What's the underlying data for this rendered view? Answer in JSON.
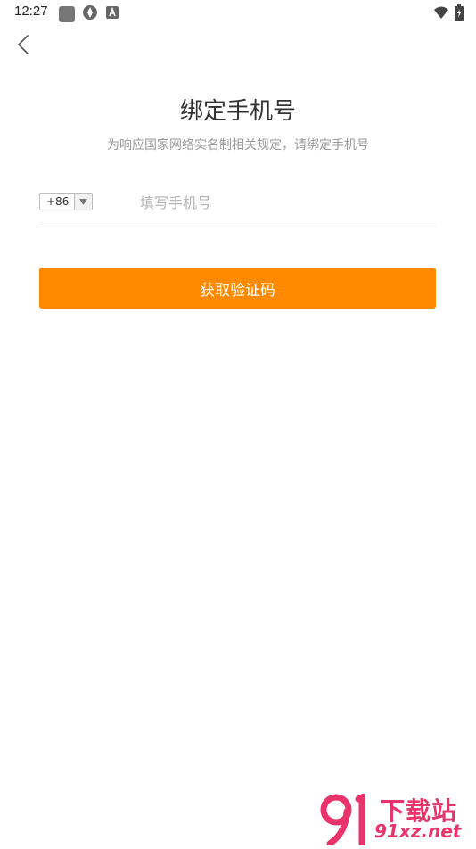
{
  "status_bar": {
    "time": "12:27"
  },
  "header": {
    "title": "绑定手机号",
    "subtitle": "为响应国家网络实名制相关规定，请绑定手机号"
  },
  "phone_form": {
    "country_code": "+86",
    "phone_value": "",
    "phone_placeholder": "填写手机号"
  },
  "submit": {
    "label": "获取验证码"
  },
  "watermark": {
    "brand_cn": "下载站",
    "brand_url": "91xz.net"
  },
  "colors": {
    "accent": "#ff8a00",
    "watermark": "#e8336b"
  },
  "icons": {
    "back": "chevron-left-icon",
    "dropdown": "triangle-down-icon",
    "wifi": "wifi-icon",
    "battery": "battery-icon"
  }
}
